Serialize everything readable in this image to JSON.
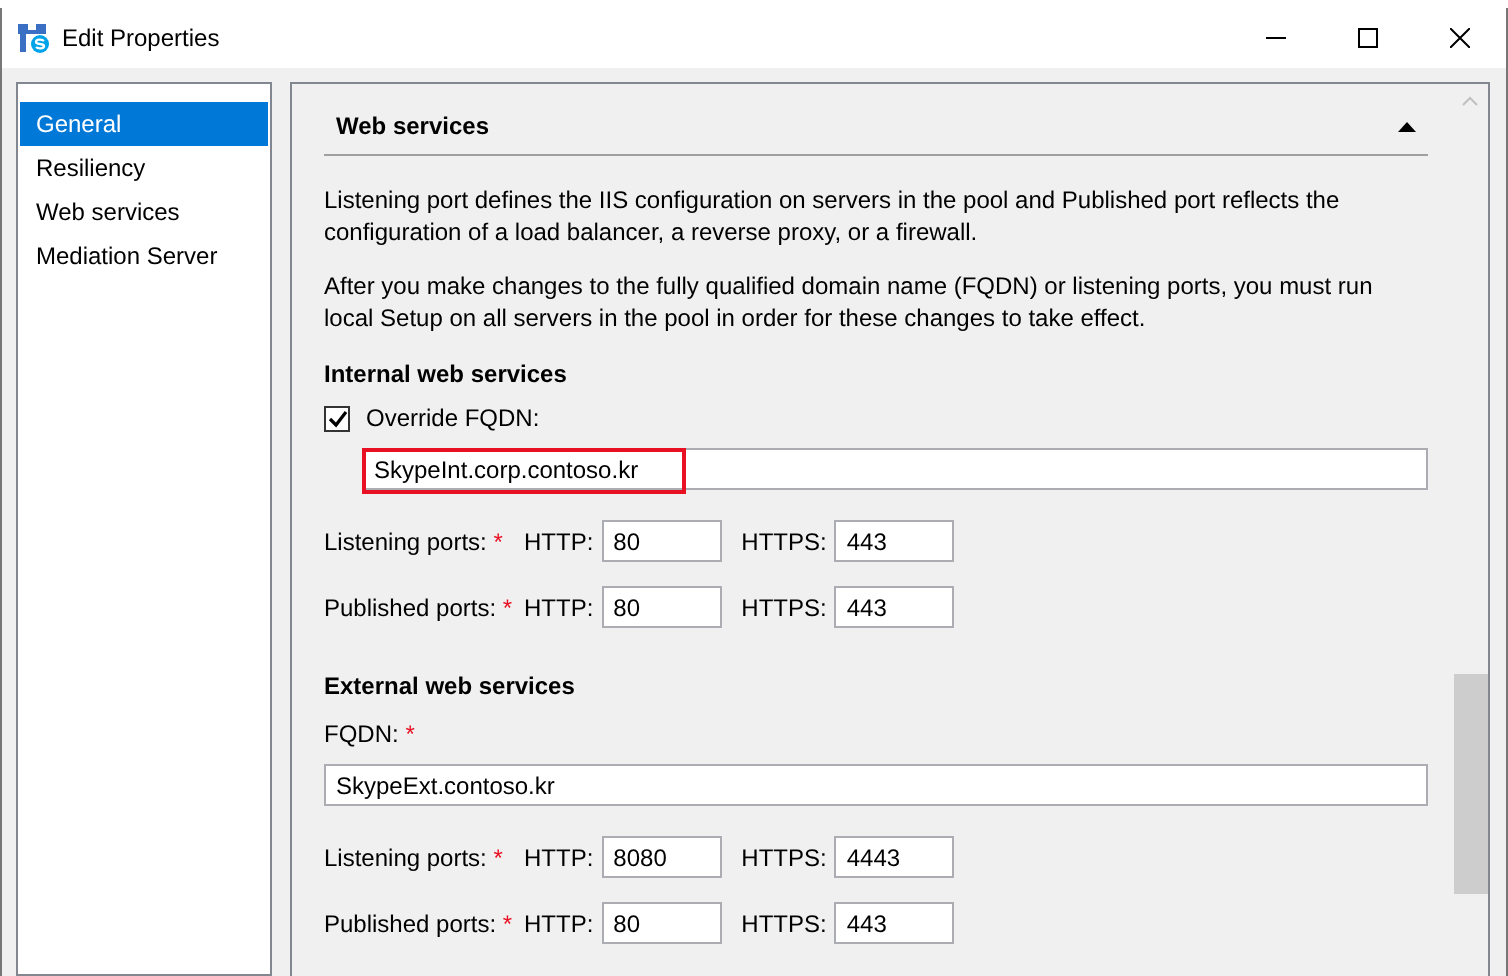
{
  "window": {
    "title": "Edit Properties"
  },
  "sidebar": {
    "items": [
      {
        "label": "General",
        "selected": true
      },
      {
        "label": "Resiliency",
        "selected": false
      },
      {
        "label": "Web services",
        "selected": false
      },
      {
        "label": "Mediation Server",
        "selected": false
      }
    ]
  },
  "section": {
    "title": "Web services",
    "expanded": true,
    "paragraphs": [
      "Listening port defines the IIS configuration on servers in the pool and Published port reflects the configuration of a load balancer, a reverse proxy, or a firewall.",
      "After you make changes to the fully qualified domain name (FQDN) or listening ports, you must run local Setup on all servers in the pool in order for these changes to take effect."
    ],
    "groups": [
      {
        "title": "Internal web services",
        "fqdn": {
          "kind": "checkbox",
          "label": "Override FQDN:",
          "checked": true,
          "value": "SkypeInt.corp.contoso.kr",
          "highlighted": true
        },
        "ports": [
          {
            "label": "Listening ports:",
            "required": "*",
            "http_label": "HTTP:",
            "http": "80",
            "https_label": "HTTPS:",
            "https": "443"
          },
          {
            "label": "Published ports:",
            "required": "*",
            "http_label": "HTTP:",
            "http": "80",
            "https_label": "HTTPS:",
            "https": "443"
          }
        ]
      },
      {
        "title": "External web services",
        "fqdn": {
          "kind": "label",
          "label": "FQDN:",
          "required": "*",
          "value": "SkypeExt.contoso.kr",
          "highlighted": false
        },
        "ports": [
          {
            "label": "Listening ports:",
            "required": "*",
            "http_label": "HTTP:",
            "http": "8080",
            "https_label": "HTTPS:",
            "https": "4443"
          },
          {
            "label": "Published ports:",
            "required": "*",
            "http_label": "HTTP:",
            "http": "80",
            "https_label": "HTTPS:",
            "https": "443"
          }
        ]
      }
    ]
  }
}
